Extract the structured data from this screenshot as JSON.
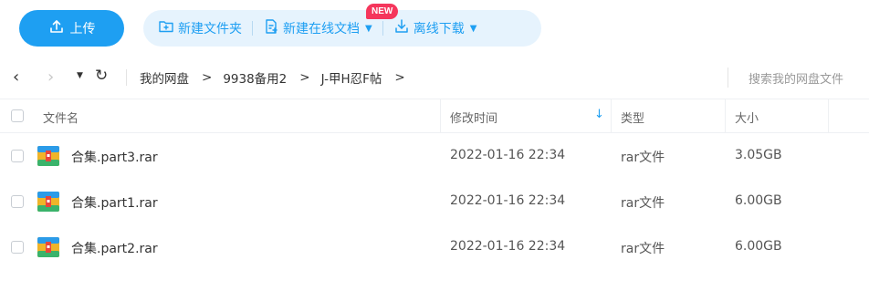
{
  "toolbar": {
    "upload_label": "上传",
    "new_folder_label": "新建文件夹",
    "new_online_doc_label": "新建在线文档",
    "new_badge": "NEW",
    "offline_download_label": "离线下载"
  },
  "nav": {
    "breadcrumbs": [
      "我的网盘",
      "9938备用2",
      "J-甲H忍F帖"
    ],
    "crumb_separator": ">",
    "search_placeholder": "搜索我的网盘文件"
  },
  "table": {
    "columns": {
      "name": "文件名",
      "modified": "修改时间",
      "type": "类型",
      "size": "大小"
    },
    "sorted_by": "修改时间",
    "sort_direction": "descending",
    "rows": [
      {
        "name": "合集.part3.rar",
        "modified": "2022-01-16 22:34",
        "type": "rar文件",
        "size": "3.05GB"
      },
      {
        "name": "合集.part1.rar",
        "modified": "2022-01-16 22:34",
        "type": "rar文件",
        "size": "6.00GB"
      },
      {
        "name": "合集.part2.rar",
        "modified": "2022-01-16 22:34",
        "type": "rar文件",
        "size": "6.00GB"
      }
    ]
  },
  "colors": {
    "accent": "#1e9ff2",
    "badge": "#f5365c",
    "toolbar_group_bg": "#e6f3fd"
  },
  "icons": {
    "upload": "upload-icon",
    "new_folder": "folder-plus-icon",
    "new_doc": "document-plus-icon",
    "download": "download-icon",
    "file": "rar-archive-icon"
  }
}
